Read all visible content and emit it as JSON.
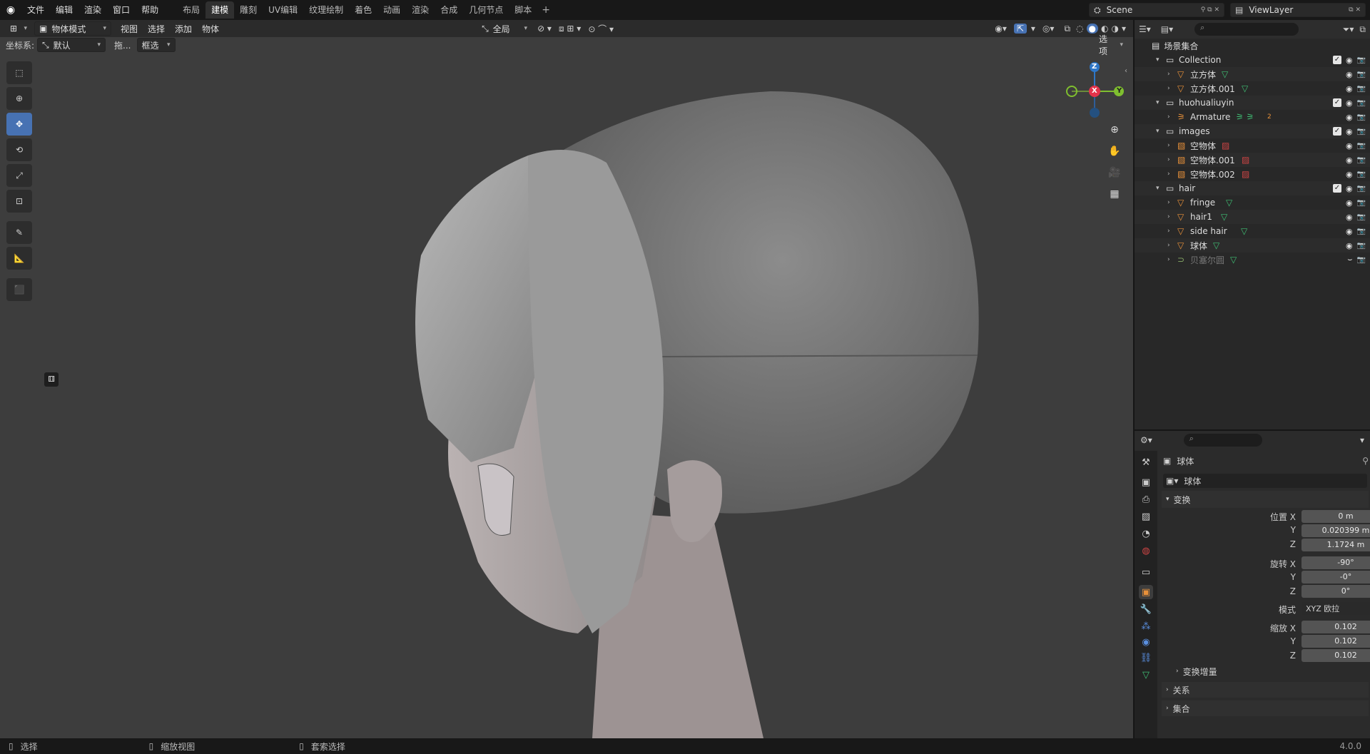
{
  "menu": {
    "file": "文件",
    "edit": "编辑",
    "render": "渲染",
    "window": "窗口",
    "help": "帮助"
  },
  "workspaces": [
    "布局",
    "建模",
    "雕刻",
    "UV编辑",
    "纹理绘制",
    "着色",
    "动画",
    "渲染",
    "合成",
    "几何节点",
    "脚本"
  ],
  "scene": {
    "name": "Scene",
    "view_layer": "ViewLayer"
  },
  "viewport": {
    "mode": "物体模式",
    "menus": [
      "视图",
      "选择",
      "添加",
      "物体"
    ],
    "transform_orientation": "全局",
    "coord_label": "坐标系:",
    "coord_value": "默认",
    "drag_label": "拖...",
    "select_mode": "框选",
    "options": "选项",
    "gizmo": {
      "x": "X",
      "y": "Y",
      "z": "Z"
    }
  },
  "outliner": {
    "root": "场景集合",
    "rows": [
      {
        "label": "Collection",
        "type": "collection"
      },
      {
        "label": "立方体",
        "type": "mesh"
      },
      {
        "label": "立方体.001",
        "type": "mesh"
      },
      {
        "label": "huohualiuyin",
        "type": "collection"
      },
      {
        "label": "Armature",
        "type": "armature",
        "badge": "2"
      },
      {
        "label": "images",
        "type": "collection"
      },
      {
        "label": "空物体",
        "type": "image"
      },
      {
        "label": "空物体.001",
        "type": "image"
      },
      {
        "label": "空物体.002",
        "type": "image"
      },
      {
        "label": "hair",
        "type": "collection"
      },
      {
        "label": "fringe",
        "type": "mesh"
      },
      {
        "label": "hair1",
        "type": "mesh"
      },
      {
        "label": "side hair",
        "type": "mesh"
      },
      {
        "label": "球体",
        "type": "mesh"
      },
      {
        "label": "贝塞尔圆",
        "type": "curve"
      }
    ]
  },
  "properties": {
    "object_name": "球体",
    "data_name": "球体",
    "transform_panel": "变换",
    "location_label": "位置 X",
    "rotation_label": "旋转 X",
    "scale_label": "缩放 X",
    "y": "Y",
    "z": "Z",
    "location": [
      "0 m",
      "0.020399 m",
      "1.1724 m"
    ],
    "rotation": [
      "-90°",
      "-0°",
      "0°"
    ],
    "mode_label": "模式",
    "mode_value": "XYZ 欧拉",
    "scale": [
      "0.102",
      "0.102",
      "0.102"
    ],
    "delta": "变换增量",
    "relations": "关系",
    "collections": "集合"
  },
  "status": {
    "select": "选择",
    "zoom": "缩放视图",
    "lasso": "套索选择",
    "version": "4.0.0"
  }
}
